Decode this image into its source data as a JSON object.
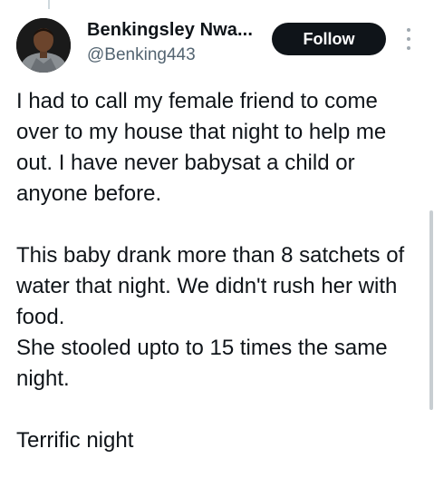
{
  "author": {
    "display_name": "Benkingsley Nwa...",
    "handle": "@Benking443",
    "avatar_icon": "profile-photo"
  },
  "actions": {
    "follow_label": "Follow",
    "more_icon": "vertical-ellipsis-icon"
  },
  "tweet": {
    "paragraph_1": "I had to call my female friend to come over to my house that night to help me out. I have never babysat a child or anyone before.",
    "paragraph_2_line_1": "This baby drank more than 8 satchets of water that night. We didn't rush her with food.",
    "paragraph_2_line_2": "She stooled upto to 15 times the same night.",
    "paragraph_3": "Terrific night"
  },
  "colors": {
    "text": "#0f1419",
    "secondary_text": "#536471",
    "follow_button_bg": "#0f1419",
    "follow_button_text": "#ffffff"
  }
}
